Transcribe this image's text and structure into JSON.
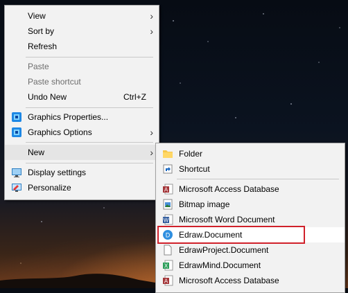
{
  "context_menu": {
    "items": [
      {
        "label": "View"
      },
      {
        "label": "Sort by"
      },
      {
        "label": "Refresh"
      },
      {
        "label": "Paste"
      },
      {
        "label": "Paste shortcut"
      },
      {
        "label": "Undo New",
        "shortcut": "Ctrl+Z"
      },
      {
        "label": "Graphics Properties..."
      },
      {
        "label": "Graphics Options"
      },
      {
        "label": "New"
      },
      {
        "label": "Display settings"
      },
      {
        "label": "Personalize"
      }
    ]
  },
  "new_submenu": {
    "items": [
      {
        "label": "Folder"
      },
      {
        "label": "Shortcut"
      },
      {
        "label": "Microsoft Access Database"
      },
      {
        "label": "Bitmap image"
      },
      {
        "label": "Microsoft Word Document"
      },
      {
        "label": "Edraw.Document"
      },
      {
        "label": "EdrawProject.Document"
      },
      {
        "label": "EdrawMind.Document"
      },
      {
        "label": "Microsoft Access Database"
      }
    ]
  },
  "colors": {
    "menu_bg": "#f2f2f2",
    "hover_bg": "#e5e5e5",
    "disabled_text": "#6d6d6d",
    "highlight_border": "#d0202a"
  }
}
